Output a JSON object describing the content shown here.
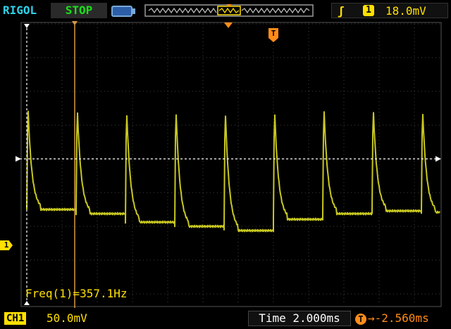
{
  "header": {
    "brand": "RIGOL",
    "run_state": "STOP",
    "trigger": {
      "edge_icon": "rising-edge-icon",
      "source": "1",
      "level": "18.0mV"
    }
  },
  "markers": {
    "trigger_position_marker": "T",
    "channel_marker": "1"
  },
  "measurement": {
    "freq_label": "Freq(1)=357.1Hz"
  },
  "footer": {
    "channel_tag": "CH1",
    "channel_scale": "50.0mV",
    "timebase": "Time 2.000ms",
    "trigger_offset": "→-2.560ms",
    "trigger_offset_badge": "T"
  },
  "colors": {
    "trace": "#c8c820",
    "cursor": "#d89a40",
    "grid": "#404040",
    "accent": "#ff8c1a",
    "channel": "#ffe000"
  },
  "waveform": {
    "period_ms": 2.8,
    "baseline_mV": -75,
    "peak_mV": 85
  }
}
